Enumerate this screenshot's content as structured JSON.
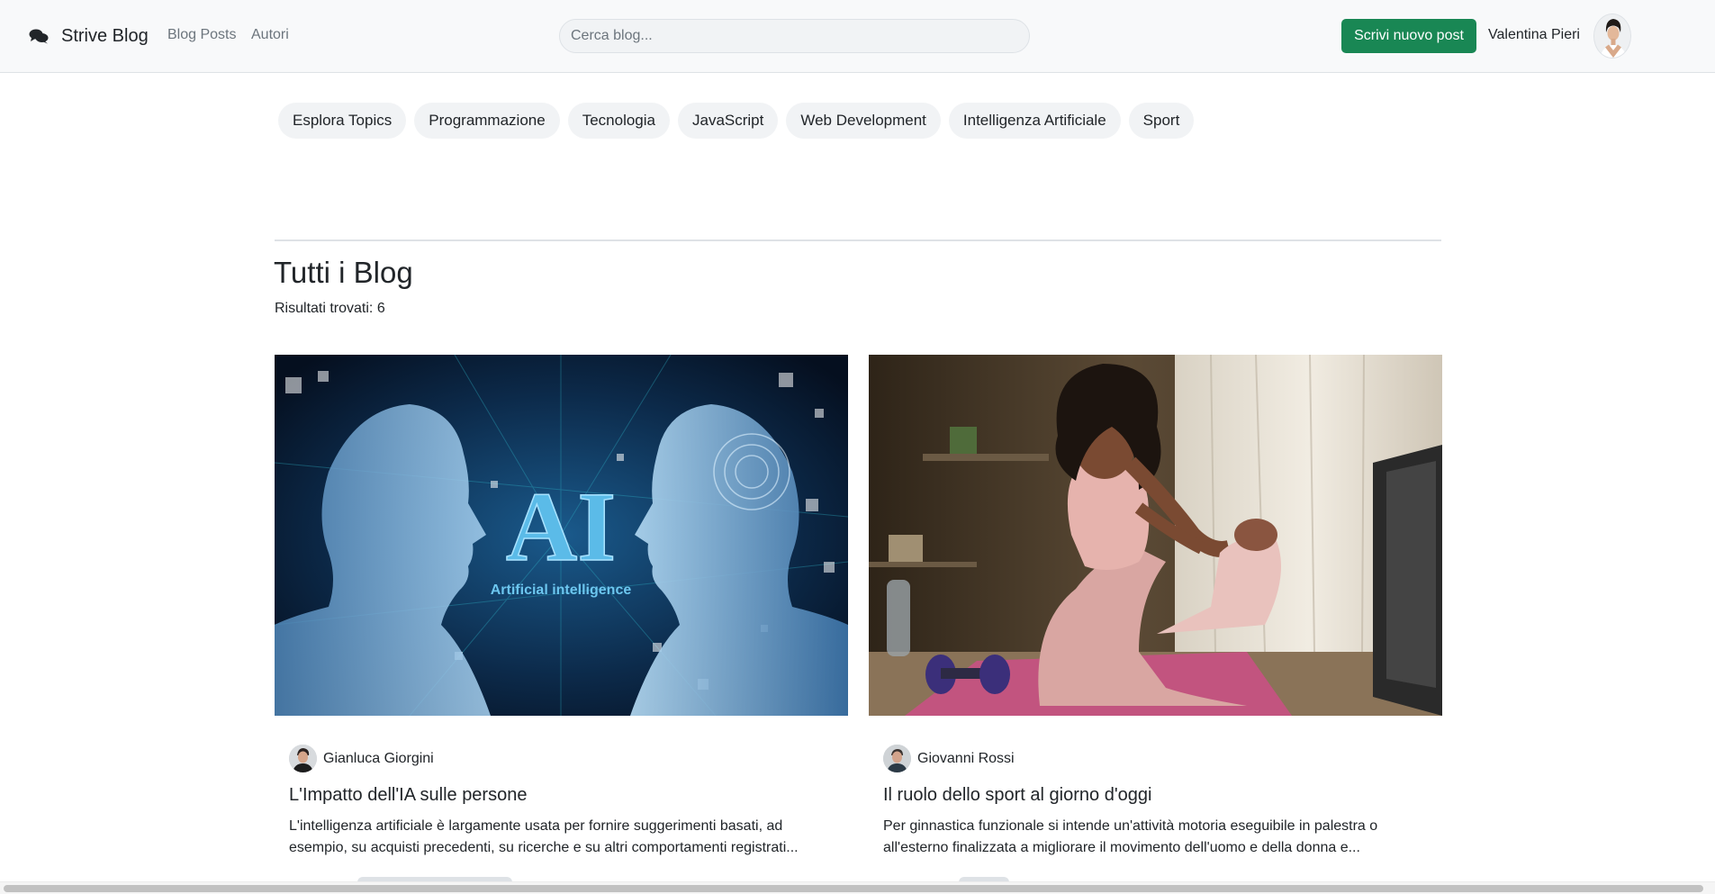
{
  "navbar": {
    "brand": "Strive Blog",
    "brand_icon": "chat-bubbles-icon",
    "links": [
      "Blog Posts",
      "Autori"
    ],
    "search_placeholder": "Cerca blog...",
    "new_post_label": "Scrivi nuovo post",
    "user_name": "Valentina Pieri",
    "accent": "#198754"
  },
  "topics": [
    "Esplora Topics",
    "Programmazione",
    "Tecnologia",
    "JavaScript",
    "Web Development",
    "Intelligenza Artificiale",
    "Sport"
  ],
  "section": {
    "title": "Tutti i Blog",
    "results": "Risultati trovati: 6"
  },
  "posts": [
    {
      "author": "Gianluca Giorgini",
      "title": "L'Impatto dell'IA sulle persone",
      "excerpt": "L'intelligenza artificiale è largamente usata per fornire suggerimenti basati, ad esempio, su acquisti precedenti, su ricerche e su altri comportamenti registrati...",
      "image_text": "AI",
      "image_caption": "Artificial intelligence"
    },
    {
      "author": "Giovanni Rossi",
      "title": "Il ruolo dello sport al giorno d'oggi",
      "excerpt": "Per ginnastica funzionale si intende un'attività motoria eseguibile in palestra o all'esterno finalizzata a migliorare il movimento dell'uomo e della donna e..."
    }
  ]
}
